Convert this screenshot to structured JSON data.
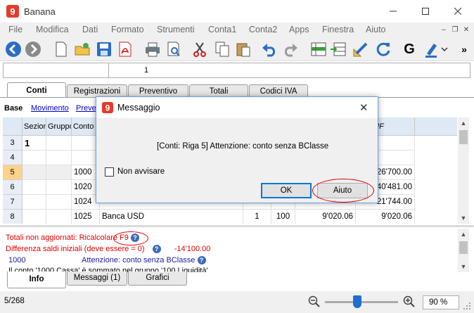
{
  "window": {
    "title": "Banana"
  },
  "menu": [
    "File",
    "Modifica",
    "Dati",
    "Formato",
    "Strumenti",
    "Conta1",
    "Conta2",
    "Apps",
    "Finestra",
    "Aiuto"
  ],
  "toolbar": {
    "overflow": "»"
  },
  "formula": {
    "value": "1"
  },
  "tabs": [
    "Conti",
    "Registrazioni",
    "Preventivo",
    "Totali",
    "Codici IVA"
  ],
  "views": [
    "Base",
    "Movimento",
    "Preve"
  ],
  "columns": [
    "",
    "Sezione",
    "Gruppo",
    "Conto",
    "",
    "",
    "",
    "",
    "do CHF"
  ],
  "rows": [
    {
      "num": "3",
      "sezione": "1",
      "gruppo": "",
      "conto": "",
      "desc": "",
      "bclasse": "",
      "gr": "",
      "saldo1": "",
      "saldo2": ""
    },
    {
      "num": "4",
      "sezione": "",
      "gruppo": "",
      "conto": "",
      "desc": "",
      "bclasse": "",
      "gr": "",
      "saldo1": "",
      "saldo2": ""
    },
    {
      "num": "5",
      "sezione": "",
      "gruppo": "",
      "conto": "1000",
      "desc": "",
      "bclasse": "",
      "gr": "",
      "saldo1": "",
      "saldo2": "26'700.00"
    },
    {
      "num": "6",
      "sezione": "",
      "gruppo": "",
      "conto": "1020",
      "desc": "",
      "bclasse": "",
      "gr": "",
      "saldo1": "",
      "saldo2": "40'481.00"
    },
    {
      "num": "7",
      "sezione": "",
      "gruppo": "",
      "conto": "1024",
      "desc": "",
      "bclasse": "",
      "gr": "",
      "saldo1": "",
      "saldo2": "21'744.00"
    },
    {
      "num": "8",
      "sezione": "",
      "gruppo": "",
      "conto": "1025",
      "desc": "Banca USD",
      "bclasse": "1",
      "gr": "100",
      "saldo1": "9'020.06",
      "saldo2": "9'020.06"
    }
  ],
  "info": {
    "line1": "Totali non aggiornati: Ricalcolare F9",
    "line2_label": "Differenza saldi iniziali (deve essere = 0)",
    "line2_value": "-14'100.00",
    "line3_account": "1000",
    "line3_msg": "Attenzione: conto senza BClasse",
    "line4": "Il conto '1000 Cassa' è sommato nel gruppo '100 Liquidità'"
  },
  "bottom_tabs": [
    "Info",
    "Messaggi (1)",
    "Grafici"
  ],
  "status": {
    "record": "5/268",
    "zoom": "90 %"
  },
  "dialog": {
    "title": "Messaggio",
    "message": "[Conti: Riga 5] Attenzione: conto senza BClasse",
    "checkbox_label": "Non avvisare",
    "ok_label": "OK",
    "help_label": "Aiuto"
  },
  "colors": {
    "accent": "#0078d7",
    "error": "#e00000",
    "brand": "#e53b2c"
  }
}
